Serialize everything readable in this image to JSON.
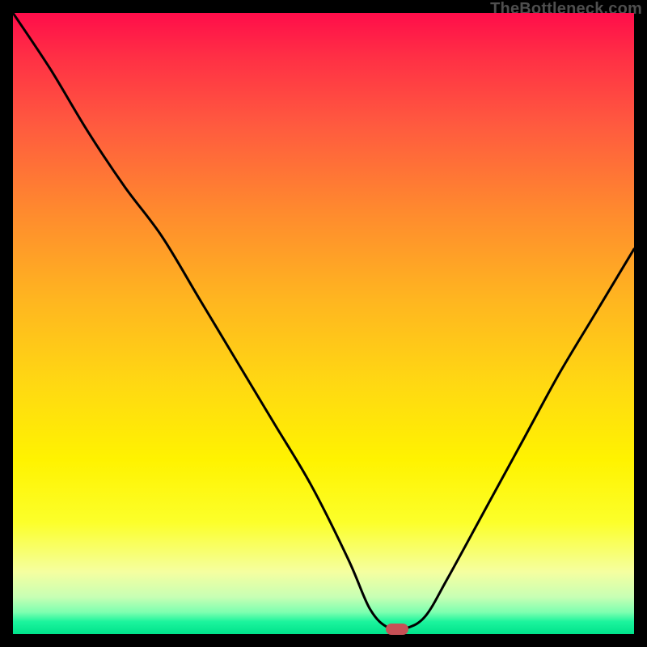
{
  "watermark": "TheBottleneck.com",
  "marker": {
    "x_frac": 0.618,
    "y_frac": 0.992
  },
  "chart_data": {
    "type": "line",
    "title": "",
    "xlabel": "",
    "ylabel": "",
    "xlim": [
      0,
      1
    ],
    "ylim": [
      0,
      1
    ],
    "series": [
      {
        "name": "bottleneck-curve",
        "x": [
          0.0,
          0.06,
          0.12,
          0.18,
          0.24,
          0.3,
          0.36,
          0.42,
          0.48,
          0.54,
          0.575,
          0.605,
          0.635,
          0.665,
          0.7,
          0.76,
          0.82,
          0.88,
          0.94,
          1.0
        ],
        "y": [
          1.0,
          0.91,
          0.81,
          0.72,
          0.64,
          0.54,
          0.44,
          0.34,
          0.24,
          0.12,
          0.04,
          0.01,
          0.01,
          0.03,
          0.09,
          0.2,
          0.31,
          0.42,
          0.52,
          0.62
        ]
      }
    ],
    "annotations": [
      {
        "type": "marker",
        "x": 0.618,
        "y": 0.008,
        "label": "optimal-point"
      }
    ]
  }
}
